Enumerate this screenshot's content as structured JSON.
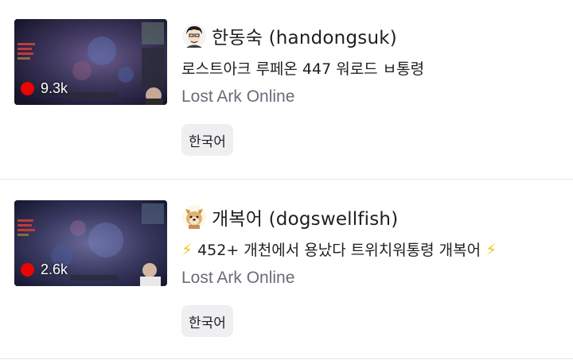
{
  "streams": [
    {
      "streamer_name": "한동숙 (handongsuk)",
      "avatar_icon": "cartoon-man-avatar-icon",
      "title": "로스트아크 루페온 447 워로드 ㅂ통령",
      "game": "Lost Ark Online",
      "viewers": "9.3k",
      "tag": "한국어"
    },
    {
      "streamer_name": "개복어 (dogswellfish)",
      "avatar_icon": "dog-avatar-icon",
      "title_prefix_icon": "⚡",
      "title": " 452+ 개천에서 용났다 트위치워통령 개복어 ",
      "title_suffix_icon": "⚡",
      "game": "Lost Ark Online",
      "viewers": "2.6k",
      "tag": "한국어"
    }
  ],
  "colors": {
    "live": "#eb0400",
    "tag_bg": "#efeff1",
    "muted": "#6b6b78"
  }
}
